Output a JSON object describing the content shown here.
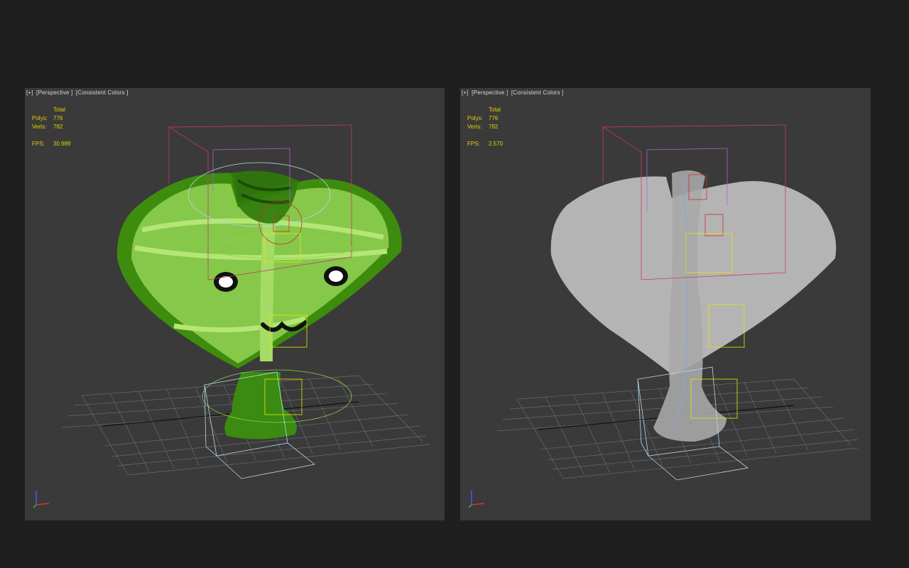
{
  "viewports": [
    {
      "label_parts": [
        "[+]",
        "[Perspective ]",
        "[Consistent Colors ]"
      ],
      "stats": {
        "total_label": "Total",
        "polys_label": "Polys:",
        "polys_value": "776",
        "verts_label": "Verts:",
        "verts_value": "782",
        "fps_label": "FPS:",
        "fps_value": "30.989"
      },
      "shading": "green-shaded"
    },
    {
      "label_parts": [
        "[+]",
        "[Perspective ]",
        "[Consistent Colors ]"
      ],
      "stats": {
        "total_label": "Total",
        "polys_label": "Polys:",
        "polys_value": "776",
        "verts_label": "Verts:",
        "verts_value": "782",
        "fps_label": "FPS:",
        "fps_value": "2.570"
      },
      "shading": "gray-xray"
    }
  ],
  "colors": {
    "background": "#1f1f1f",
    "viewport": "#3a3a3a",
    "stats_text": "#e3d200",
    "heart_green_light": "#8fd24a",
    "heart_green_dark": "#3f8e0c",
    "heart_gray": "#b4b4b4",
    "bone_yellow": "#e8e800",
    "bone_red": "#c83030",
    "bone_purple": "#b060d0",
    "bone_magenta": "#c8386a",
    "bone_lightblue": "#b8d8f0"
  }
}
